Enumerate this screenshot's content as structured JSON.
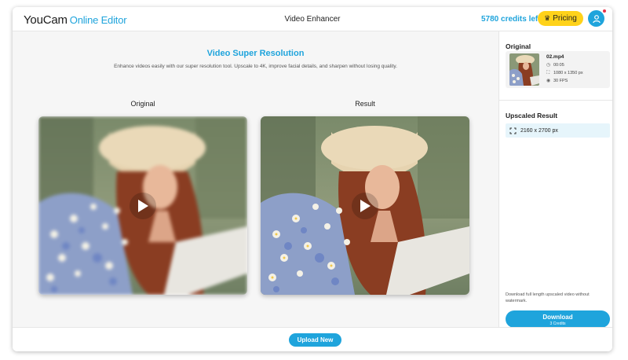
{
  "header": {
    "brand": "YouCam",
    "brand_sub": "Online Editor",
    "title": "Video Enhancer",
    "credits": "5780 credits left",
    "pricing_label": "Pricing"
  },
  "main": {
    "title": "Video Super Resolution",
    "description": "Enhance videos easily with our super resolution tool. Upscale to 4K, improve facial details, and sharpen without losing quality.",
    "original_label": "Original",
    "result_label": "Result"
  },
  "sidebar": {
    "original_heading": "Original",
    "file": {
      "name": "02.mp4",
      "duration": "00:05",
      "resolution": "1080 x 1350 px",
      "fps": "30 FPS"
    },
    "upscaled_heading": "Upscaled Result",
    "upscaled_resolution": "2160 x 2700 px",
    "download_note": "Download full length upscaled video without watermark.",
    "download_label": "Download",
    "download_cost": "3 Credits"
  },
  "footer": {
    "upload_label": "Upload New"
  },
  "colors": {
    "accent": "#1fa4dc",
    "pricing": "#ffd21a"
  }
}
